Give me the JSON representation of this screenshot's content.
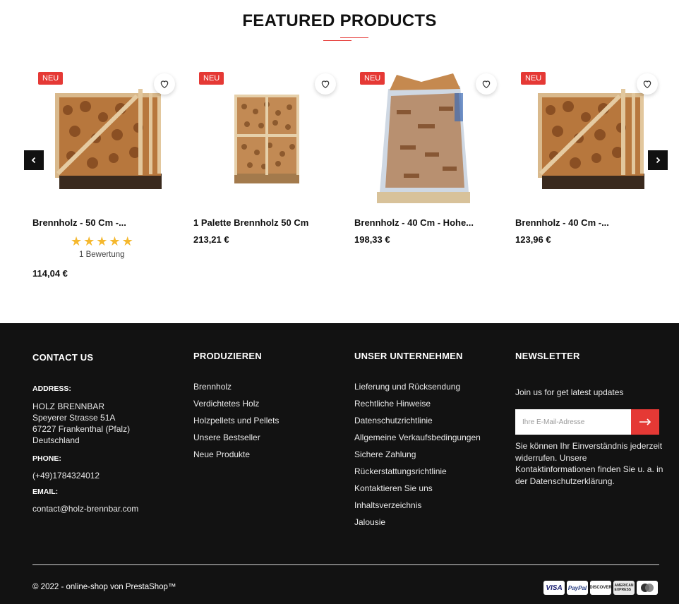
{
  "featured": {
    "title": "FEATURED PRODUCTS",
    "products": [
      {
        "badge": "NEU",
        "name": "Brennholz - 50 Cm -...",
        "rating": 5,
        "reviews": "1 Bewertung",
        "price": "114,04 €"
      },
      {
        "badge": "NEU",
        "name": "1 Palette Brennholz 50 Cm",
        "price": "213,21 €"
      },
      {
        "badge": "NEU",
        "name": "Brennholz - 40 Cm - Hohe...",
        "price": "198,33 €"
      },
      {
        "badge": "NEU",
        "name": "Brennholz - 40 Cm -...",
        "price": "123,96 €"
      }
    ]
  },
  "footer": {
    "contact": {
      "title": "CONTACT US",
      "address_label": "ADDRESS:",
      "address_lines": [
        "HOLZ BRENNBAR",
        "Speyerer Strasse 51A",
        "67227 Frankenthal (Pfalz)",
        "Deutschland"
      ],
      "phone_label": "PHONE:",
      "phone": "(+49)1784324012",
      "email_label": "EMAIL:",
      "email": "contact@holz-brennbar.com"
    },
    "produzieren": {
      "title": "PRODUZIEREN",
      "links": [
        "Brennholz",
        "Verdichtetes Holz",
        "Holzpellets und Pellets",
        "Unsere Bestseller",
        "Neue Produkte"
      ]
    },
    "unternehmen": {
      "title": "UNSER UNTERNEHMEN",
      "links": [
        "Lieferung und Rücksendung",
        "Rechtliche Hinweise",
        "Datenschutzrichtlinie",
        "Allgemeine Verkaufsbedingungen",
        "Sichere Zahlung",
        "Rückerstattungsrichtlinie",
        "Kontaktieren Sie uns",
        "Inhaltsverzeichnis",
        "Jalousie"
      ]
    },
    "newsletter": {
      "title": "NEWSLETTER",
      "intro": "Join us for get latest updates",
      "placeholder": "Ihre E-Mail-Adresse",
      "note": "Sie können Ihr Einverständnis jederzeit widerrufen. Unsere Kontaktinformationen finden Sie u. a. in der Datenschutzerklärung."
    },
    "copyright": "© 2022 - online-shop von PrestaShop™",
    "payments": [
      "VISA",
      "PayPal",
      "DISCOVER",
      "AMERICAN EXPRESS",
      "mastercard"
    ]
  },
  "colors": {
    "accent": "#e53935",
    "footer_bg": "#121212"
  }
}
